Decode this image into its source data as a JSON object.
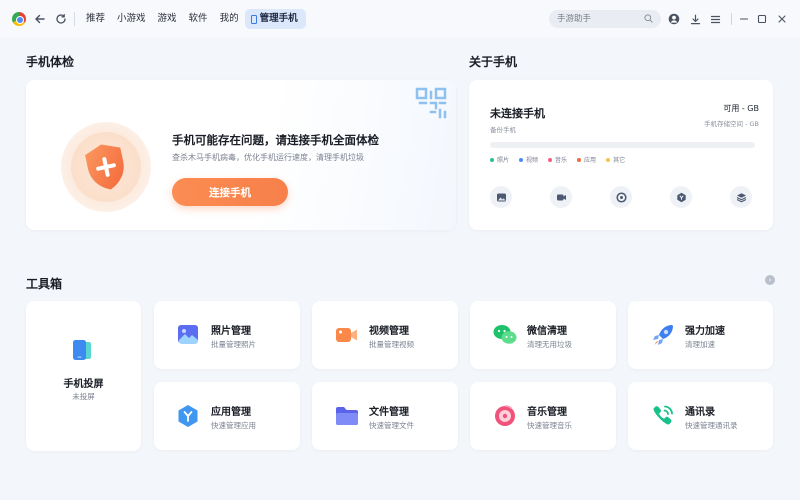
{
  "topbar": {
    "tabs": [
      {
        "label": "推荐"
      },
      {
        "label": "小游戏"
      },
      {
        "label": "游戏"
      },
      {
        "label": "软件"
      },
      {
        "label": "我的"
      }
    ],
    "active_tab": {
      "label": "管理手机"
    },
    "search_placeholder": "手游助手",
    "icons": {
      "back": "back-arrow-icon",
      "refresh": "refresh-icon",
      "search": "search-icon",
      "user": "user-icon",
      "download": "download-icon",
      "menu": "menu-icon",
      "minimize": "minimize-icon",
      "maximize": "maximize-icon",
      "close": "close-icon"
    }
  },
  "checkup": {
    "section_title": "手机体检",
    "title": "手机可能存在问题，请连接手机全面体检",
    "subtitle": "查杀木马手机病毒，优化手机运行速度，清理手机垃圾",
    "button_label": "连接手机"
  },
  "about": {
    "section_title": "关于手机",
    "title": "未连接手机",
    "subtitle": "备份手机",
    "available": "可用 - GB",
    "storage_space": "手机存储空间 - GB",
    "legend": [
      {
        "label": "照片",
        "color": "#2fc18c"
      },
      {
        "label": "视频",
        "color": "#4a8df6"
      },
      {
        "label": "音乐",
        "color": "#f25d7d"
      },
      {
        "label": "应用",
        "color": "#ef6a3c"
      },
      {
        "label": "其它",
        "color": "#f6c544"
      }
    ],
    "icons": [
      "photo-icon",
      "video-icon",
      "music-icon",
      "app-icon",
      "layers-icon"
    ]
  },
  "toolbox": {
    "section_title": "工具箱",
    "more_glyph": "›",
    "screen_cast": {
      "title": "手机投屏",
      "subtitle": "未投屏"
    },
    "tools": [
      {
        "title": "照片管理",
        "subtitle": "批量管理照片"
      },
      {
        "title": "视频管理",
        "subtitle": "批量管理视频"
      },
      {
        "title": "微信清理",
        "subtitle": "清理无用垃圾"
      },
      {
        "title": "强力加速",
        "subtitle": "清理加速"
      },
      {
        "title": "应用管理",
        "subtitle": "快速管理应用"
      },
      {
        "title": "文件管理",
        "subtitle": "快速管理文件"
      },
      {
        "title": "音乐管理",
        "subtitle": "快速管理音乐"
      },
      {
        "title": "通讯录",
        "subtitle": "快速管理通讯录"
      }
    ]
  },
  "colors": {
    "accent_blue": "#3a78e6",
    "orange_button": "#f7804a",
    "background": "#f3f6fa"
  }
}
